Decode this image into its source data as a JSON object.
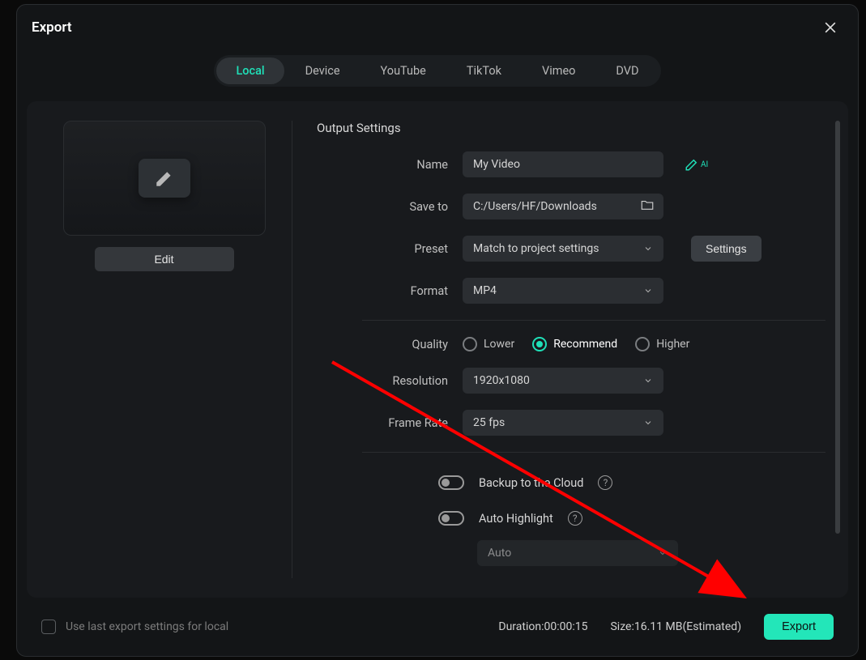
{
  "dialog": {
    "title": "Export",
    "tabs": [
      "Local",
      "Device",
      "YouTube",
      "TikTok",
      "Vimeo",
      "DVD"
    ],
    "active_tab_index": 0
  },
  "preview": {
    "edit_label": "Edit"
  },
  "settings": {
    "section_title": "Output Settings",
    "name_label": "Name",
    "name_value": "My Video",
    "save_to_label": "Save to",
    "save_to_value": "C:/Users/HF/Downloads",
    "preset_label": "Preset",
    "preset_value": "Match to project settings",
    "settings_button": "Settings",
    "format_label": "Format",
    "format_value": "MP4",
    "quality_label": "Quality",
    "quality_options": [
      "Lower",
      "Recommend",
      "Higher"
    ],
    "quality_selected_index": 1,
    "resolution_label": "Resolution",
    "resolution_value": "1920x1080",
    "framerate_label": "Frame Rate",
    "framerate_value": "25 fps",
    "backup_label": "Backup to the Cloud",
    "highlight_label": "Auto Highlight",
    "highlight_mode_value": "Auto"
  },
  "footer": {
    "use_last_label": "Use last export settings for local",
    "duration_label": "Duration:",
    "duration_value": "00:00:15",
    "size_label": "Size:",
    "size_value": "16.11 MB",
    "size_suffix": "(Estimated)",
    "export_button": "Export"
  }
}
